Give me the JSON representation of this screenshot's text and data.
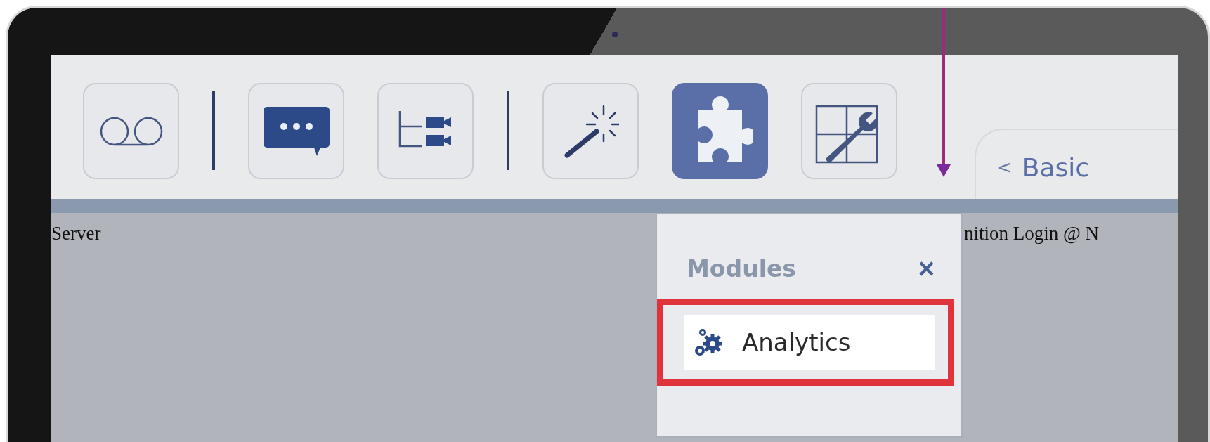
{
  "toolbar": {
    "buttons": [
      {
        "kind": "voicemail",
        "selected": false
      },
      {
        "kind": "separator"
      },
      {
        "kind": "chat",
        "selected": false
      },
      {
        "kind": "tree",
        "selected": false
      },
      {
        "kind": "separator"
      },
      {
        "kind": "wand",
        "selected": false
      },
      {
        "kind": "puzzle",
        "selected": true
      },
      {
        "kind": "grid-wrench",
        "selected": false
      }
    ],
    "tab": {
      "chevron": "<",
      "label": "Basic"
    }
  },
  "content": {
    "left_text": "Server",
    "right_text": "nition Login @ N"
  },
  "modules_popup": {
    "title": "Modules",
    "close": "×",
    "items": [
      {
        "label": "Analytics",
        "selected": true,
        "highlighted": true
      }
    ]
  }
}
